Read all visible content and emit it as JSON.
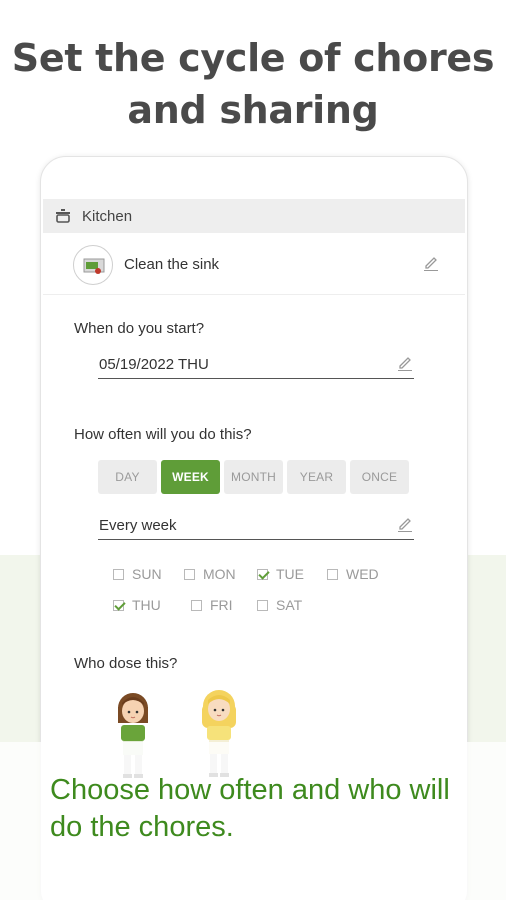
{
  "headline": "Set the cycle of chores and sharing",
  "category": {
    "label": "Kitchen",
    "icon": "pot-icon"
  },
  "task": {
    "label": "Clean the sink",
    "icon": "sink-icon"
  },
  "start": {
    "title": "When do you start?",
    "date": "05/19/2022 THU"
  },
  "frequency": {
    "title": "How often will you do this?",
    "options": [
      "DAY",
      "WEEK",
      "MONTH",
      "YEAR",
      "ONCE"
    ],
    "selected": "WEEK",
    "value": "Every week"
  },
  "weekdays": [
    {
      "label": "SUN",
      "checked": false
    },
    {
      "label": "MON",
      "checked": false
    },
    {
      "label": "TUE",
      "checked": true
    },
    {
      "label": "WED",
      "checked": false
    },
    {
      "label": "THU",
      "checked": true
    },
    {
      "label": "FRI",
      "checked": false
    },
    {
      "label": "SAT",
      "checked": false
    }
  ],
  "who": {
    "title": "Who dose this?",
    "people": [
      "brown-haired-person",
      "blonde-person"
    ]
  },
  "caption": "Choose how often and who will do the chores.",
  "colors": {
    "accent": "#5f9d38",
    "caption": "#3e8a1e",
    "band": "#f2f6ec"
  }
}
